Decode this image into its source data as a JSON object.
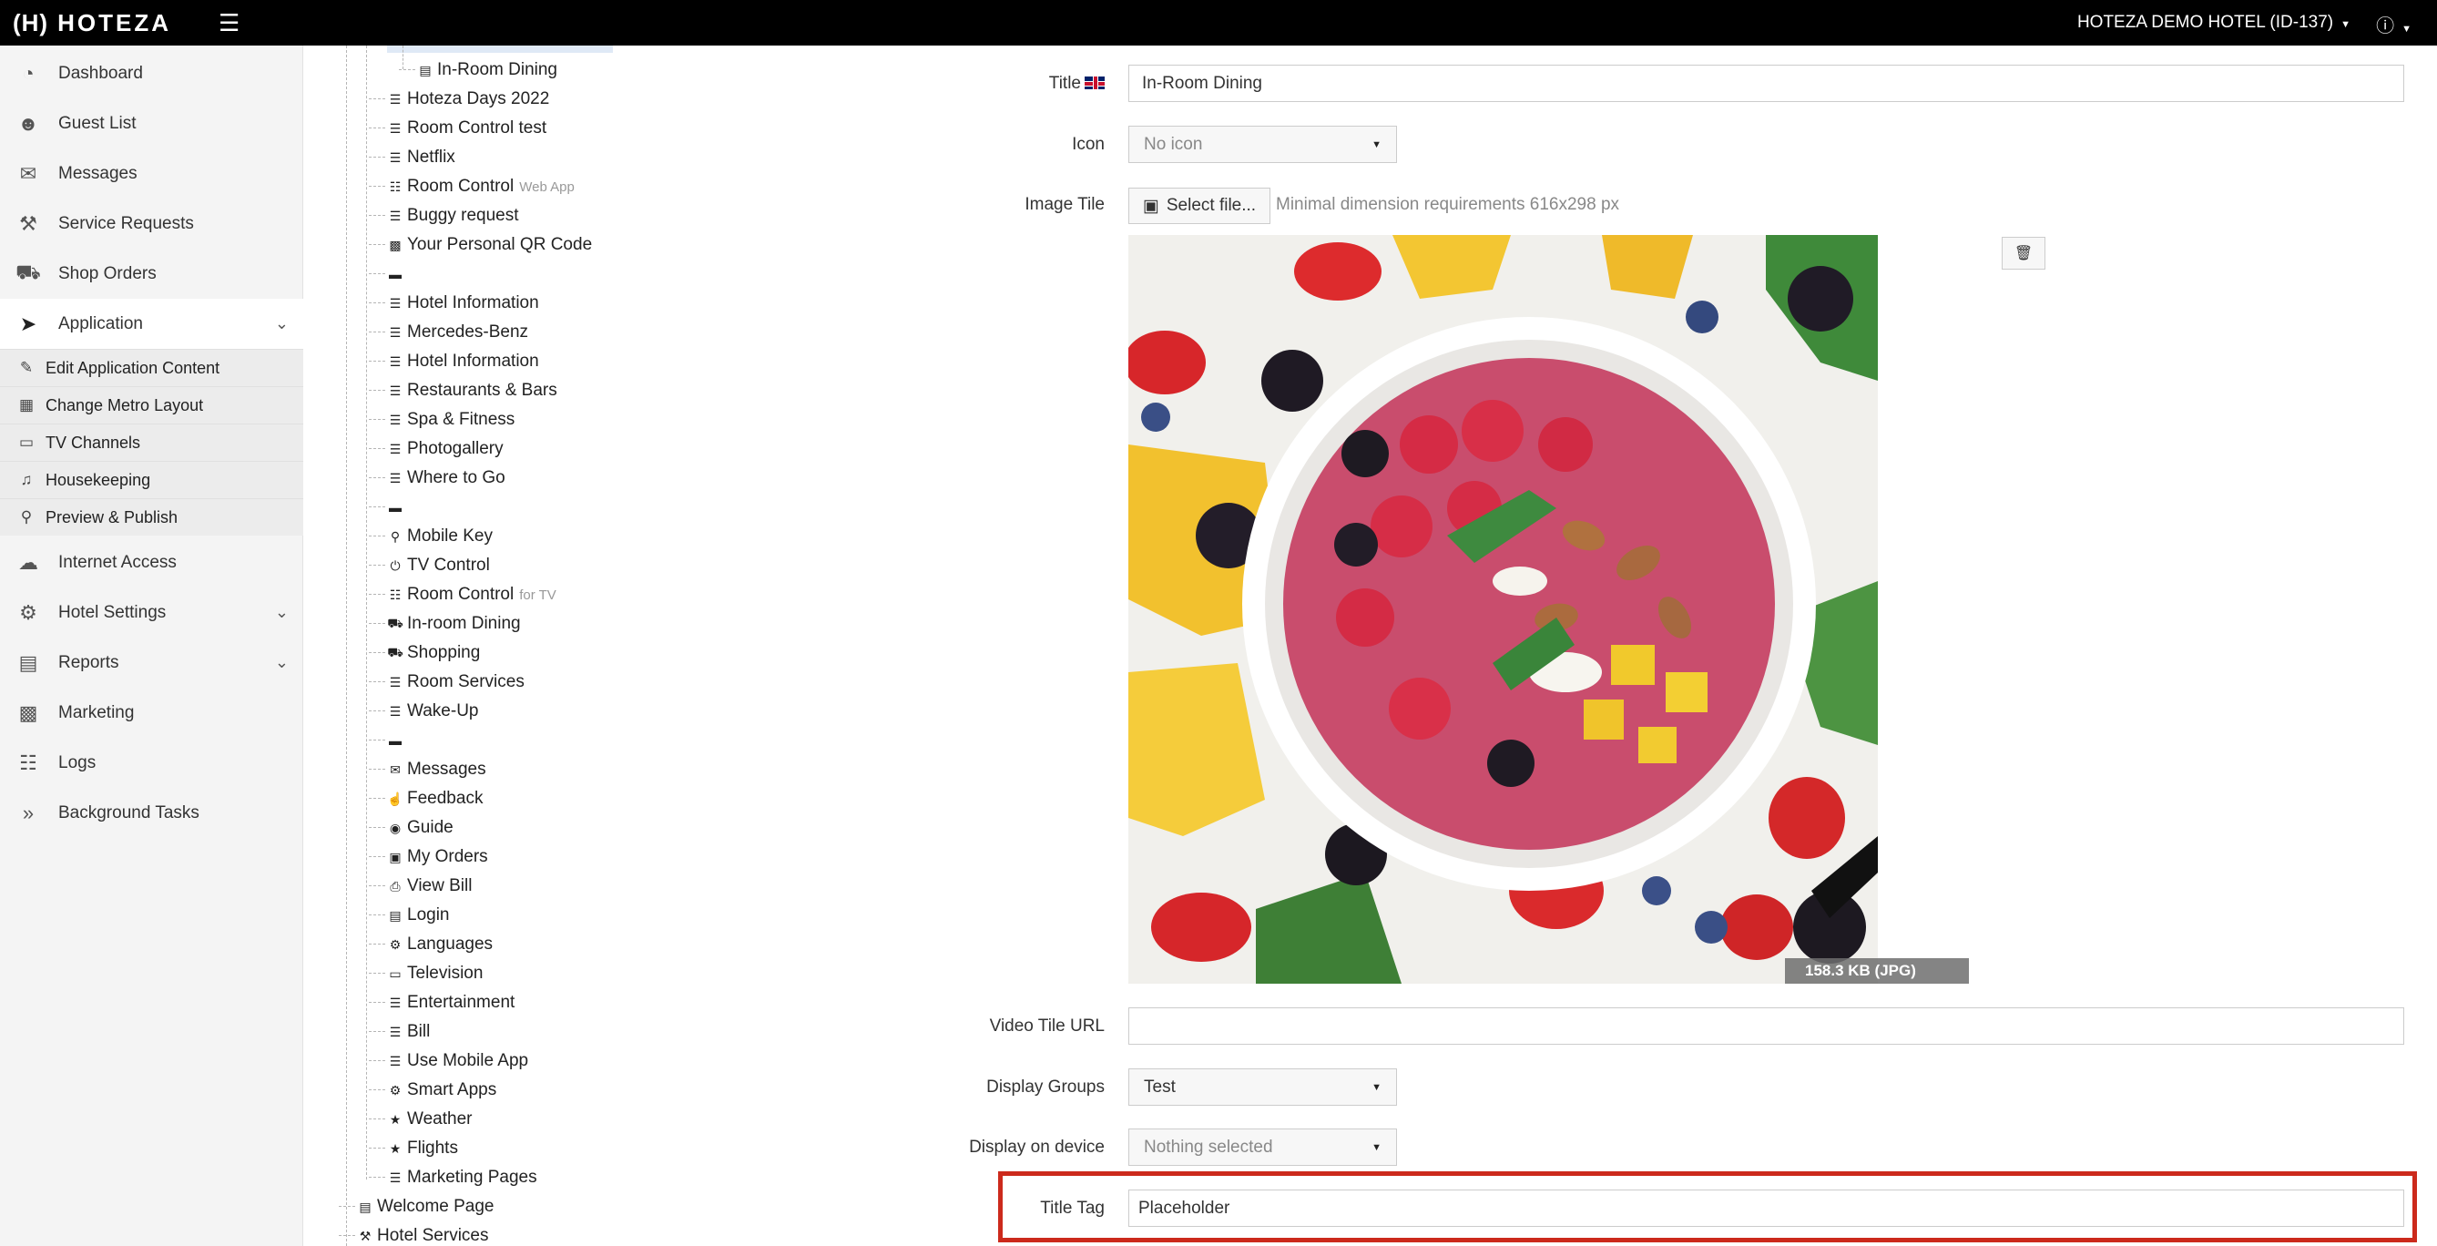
{
  "topbar": {
    "logo_mark": "(H)",
    "logo_text": "HOTEZA",
    "hotel_name": "HOTEZA DEMO HOTEL (ID-137)"
  },
  "sidebar": {
    "items": [
      {
        "label": "Dashboard",
        "icon": "dashboard-icon"
      },
      {
        "label": "Guest List",
        "icon": "users-icon"
      },
      {
        "label": "Messages",
        "icon": "chat-icon"
      },
      {
        "label": "Service Requests",
        "icon": "wrench-icon"
      },
      {
        "label": "Shop Orders",
        "icon": "cart-icon"
      },
      {
        "label": "Application",
        "icon": "rocket-icon"
      },
      {
        "label": "Internet Access",
        "icon": "cloud-icon"
      },
      {
        "label": "Hotel Settings",
        "icon": "gears-icon"
      },
      {
        "label": "Reports",
        "icon": "bar-chart-icon"
      },
      {
        "label": "Marketing",
        "icon": "briefcase-icon"
      },
      {
        "label": "Logs",
        "icon": "list-icon"
      },
      {
        "label": "Background Tasks",
        "icon": "double-chevron-icon"
      }
    ],
    "subitems": [
      {
        "label": "Edit Application Content",
        "icon": "edit-icon"
      },
      {
        "label": "Change Metro Layout",
        "icon": "grid-icon"
      },
      {
        "label": "TV Channels",
        "icon": "monitor-icon"
      },
      {
        "label": "Housekeeping",
        "icon": "bell-icon"
      },
      {
        "label": "Preview & Publish",
        "icon": "search-icon"
      }
    ]
  },
  "tree": {
    "nodes": [
      {
        "label": "In-Room Dining",
        "sub": ""
      },
      {
        "label": "Hoteza Days 2022",
        "sub": ""
      },
      {
        "label": "Room Control test",
        "sub": ""
      },
      {
        "label": "Netflix",
        "sub": ""
      },
      {
        "label": "Room Control",
        "sub": "Web App"
      },
      {
        "label": "Buggy request",
        "sub": ""
      },
      {
        "label": "Your Personal QR Code",
        "sub": ""
      },
      {
        "label": "",
        "sub": ""
      },
      {
        "label": "Hotel Information",
        "sub": ""
      },
      {
        "label": "Mercedes-Benz",
        "sub": ""
      },
      {
        "label": "Hotel Information",
        "sub": ""
      },
      {
        "label": "Restaurants & Bars",
        "sub": ""
      },
      {
        "label": "Spa & Fitness",
        "sub": ""
      },
      {
        "label": "Photogallery",
        "sub": ""
      },
      {
        "label": "Where to Go",
        "sub": ""
      },
      {
        "label": "",
        "sub": ""
      },
      {
        "label": "Mobile Key",
        "sub": ""
      },
      {
        "label": "TV Control",
        "sub": ""
      },
      {
        "label": "Room Control",
        "sub": "for TV"
      },
      {
        "label": "In-room Dining",
        "sub": ""
      },
      {
        "label": "Shopping",
        "sub": ""
      },
      {
        "label": "Room Services",
        "sub": ""
      },
      {
        "label": "Wake-Up",
        "sub": ""
      },
      {
        "label": "",
        "sub": ""
      },
      {
        "label": "Messages",
        "sub": ""
      },
      {
        "label": "Feedback",
        "sub": ""
      },
      {
        "label": "Guide",
        "sub": ""
      },
      {
        "label": "My Orders",
        "sub": ""
      },
      {
        "label": "View Bill",
        "sub": ""
      },
      {
        "label": "Login",
        "sub": ""
      },
      {
        "label": "Languages",
        "sub": ""
      },
      {
        "label": "Television",
        "sub": ""
      },
      {
        "label": "Entertainment",
        "sub": ""
      },
      {
        "label": "Bill",
        "sub": ""
      },
      {
        "label": "Use Mobile App",
        "sub": ""
      },
      {
        "label": "Smart Apps",
        "sub": ""
      },
      {
        "label": "Weather",
        "sub": ""
      },
      {
        "label": "Flights",
        "sub": ""
      },
      {
        "label": "Marketing Pages",
        "sub": ""
      },
      {
        "label": "Welcome Page",
        "sub": ""
      },
      {
        "label": "Hotel Services",
        "sub": ""
      }
    ]
  },
  "form": {
    "title_label": "Title",
    "title_value": "In-Room Dining",
    "icon_label": "Icon",
    "icon_value": "No icon",
    "image_tile_label": "Image Tile",
    "select_file_label": "Select file...",
    "image_hint": "Minimal dimension requirements 616x298 px",
    "image_size": "158.3 KB (JPG)",
    "video_label": "Video Tile URL",
    "video_value": "",
    "display_groups_label": "Display Groups",
    "display_groups_value": "Test",
    "display_device_label": "Display on device",
    "display_device_value": "Nothing selected",
    "title_tag_label": "Title Tag",
    "title_tag_value": "Placeholder"
  },
  "colors": {
    "topbar": "#000000",
    "sidebar_bg": "#f4f4f4",
    "highlight": "#cc2a1c"
  }
}
